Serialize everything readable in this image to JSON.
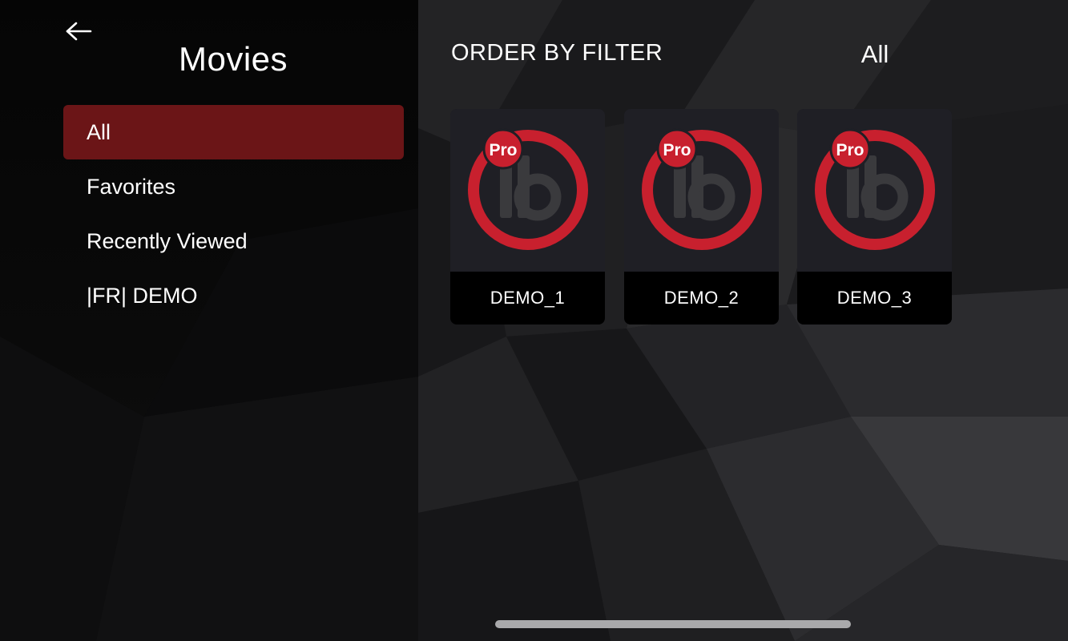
{
  "header": {
    "back_icon": "arrow-left-icon",
    "title": "Movies"
  },
  "categories": [
    {
      "label": "All",
      "selected": true
    },
    {
      "label": "Favorites",
      "selected": false
    },
    {
      "label": "Recently Viewed",
      "selected": false
    },
    {
      "label": "|FR| DEMO",
      "selected": false
    }
  ],
  "filter": {
    "label": "ORDER BY FILTER",
    "value": "All"
  },
  "movies": [
    {
      "title": "DEMO_1",
      "logo_badge": "Pro",
      "logo_icon": "ibo-pro-logo-icon"
    },
    {
      "title": "DEMO_2",
      "logo_badge": "Pro",
      "logo_icon": "ibo-pro-logo-icon"
    },
    {
      "title": "DEMO_3",
      "logo_badge": "Pro",
      "logo_icon": "ibo-pro-logo-icon"
    }
  ],
  "colors": {
    "selected_bg": "#6b1517",
    "logo_red": "#c8202e",
    "logo_grey": "#3a3a3d"
  }
}
